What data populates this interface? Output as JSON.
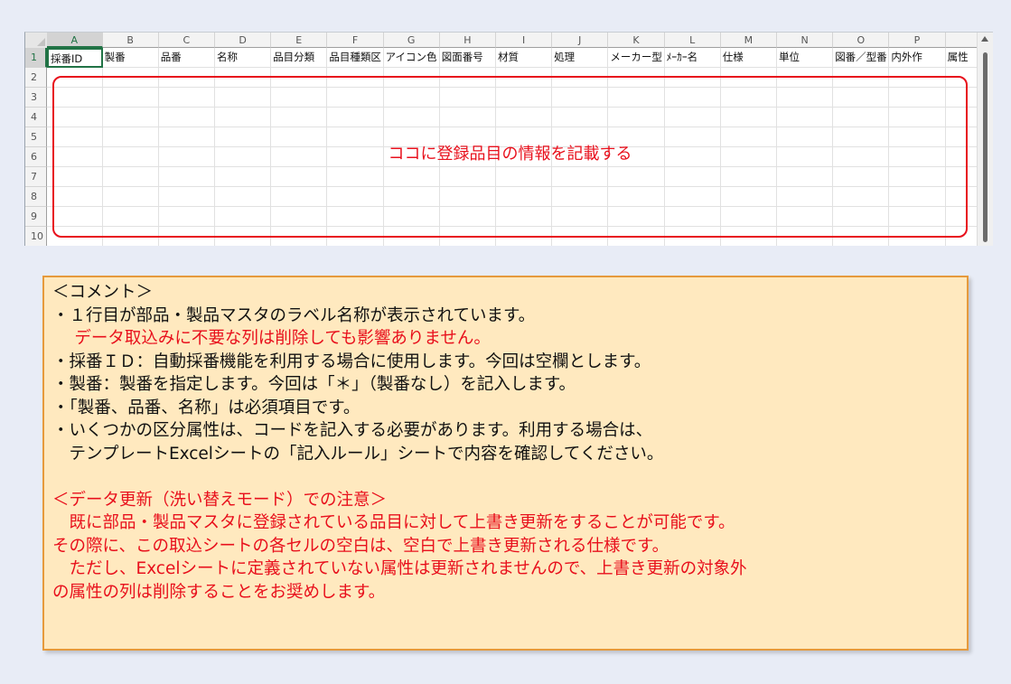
{
  "sheet": {
    "columns": [
      "A",
      "B",
      "C",
      "D",
      "E",
      "F",
      "G",
      "H",
      "I",
      "J",
      "K",
      "L",
      "M",
      "N",
      "O",
      "P"
    ],
    "header_row": [
      "採番ID",
      "製番",
      "品番",
      "名称",
      "品目分類",
      "品目種類区",
      "アイコン色",
      "図面番号",
      "材質",
      "処理",
      "メーカー型",
      "ﾒｰｶｰ名",
      "仕様",
      "単位",
      "図番／型番",
      "内外作"
    ],
    "extra_header": "属性",
    "rows": [
      "1",
      "2",
      "3",
      "4",
      "5",
      "6",
      "7",
      "8",
      "9",
      "10"
    ],
    "note": "ココに登録品目の情報を記載する"
  },
  "comment": {
    "lines": [
      {
        "text": "＜コメント＞",
        "color": "black"
      },
      {
        "text": "・１行目が部品・製品マスタのラベル名称が表示されています。",
        "color": "black"
      },
      {
        "text": "　 データ取込みに不要な列は削除しても影響ありません。",
        "color": "red"
      },
      {
        "text": "・採番ＩＤ：自動採番機能を利用する場合に使用します。今回は空欄とします。",
        "color": "black"
      },
      {
        "text": "・製番：製番を指定します。今回は「＊」（製番なし）を記入します。",
        "color": "black"
      },
      {
        "text": "・「製番、品番、名称」は必須項目です。",
        "color": "black"
      },
      {
        "text": "・いくつかの区分属性は、コードを記入する必要があります。利用する場合は、",
        "color": "black"
      },
      {
        "text": "　テンプレートExcelシートの「記入ルール」シートで内容を確認してください。",
        "color": "black"
      },
      {
        "text": "",
        "color": "black"
      },
      {
        "text": "＜データ更新（洗い替えモード）での注意＞",
        "color": "red"
      },
      {
        "text": "　既に部品・製品マスタに登録されている品目に対して上書き更新をすることが可能です。",
        "color": "red"
      },
      {
        "text": "その際に、この取込シートの各セルの空白は、空白で上書き更新される仕様です。",
        "color": "red"
      },
      {
        "text": "　ただし、Excelシートに定義されていない属性は更新されませんので、上書き更新の対象外",
        "color": "red"
      },
      {
        "text": "の属性の列は削除することをお奨めします。",
        "color": "red"
      }
    ]
  },
  "colors": {
    "accent_green": "#217346",
    "annotation_red": "#e8101c",
    "comment_bg": "#ffe9bf",
    "comment_border": "#e69a3c"
  }
}
